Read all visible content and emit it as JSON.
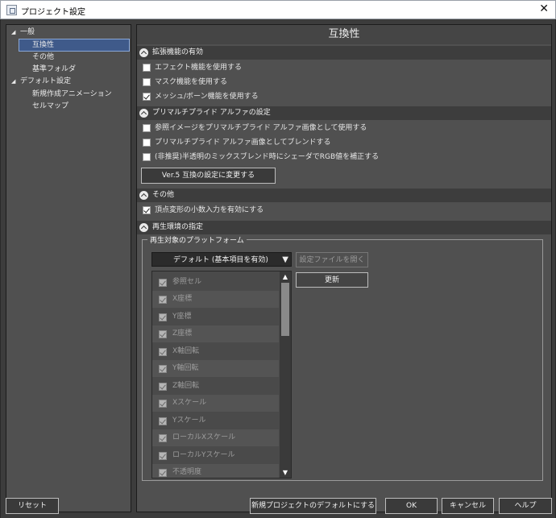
{
  "window": {
    "title": "プロジェクト設定",
    "close_label": "✕"
  },
  "tree": {
    "items": [
      {
        "label": "一般",
        "expanded": true
      },
      {
        "label": "互換性",
        "selected": true
      },
      {
        "label": "その他"
      },
      {
        "label": "基準フォルダ"
      },
      {
        "label": "デフォルト設定",
        "expanded": true
      },
      {
        "label": "新規作成アニメーション"
      },
      {
        "label": "セルマップ"
      }
    ]
  },
  "panel": {
    "title": "互換性"
  },
  "sections": {
    "extensions": {
      "header": "拡張機能の有効",
      "options": [
        {
          "label": "エフェクト機能を使用する",
          "checked": false
        },
        {
          "label": "マスク機能を使用する",
          "checked": false
        },
        {
          "label": "メッシュ/ボーン機能を使用する",
          "checked": true
        }
      ]
    },
    "premultiplied": {
      "header": "プリマルチプライド アルファの設定",
      "options": [
        {
          "label": "参照イメージをプリマルチプライド アルファ画像として使用する",
          "checked": false
        },
        {
          "label": "プリマルチプライド アルファ画像としてブレンドする",
          "checked": false
        },
        {
          "label": "(非推奨)半透明のミックスブレンド時にシェーダでRGB値を補正する",
          "checked": false
        }
      ],
      "button": "Ver.5 互換の設定に変更する"
    },
    "other": {
      "header": "その他",
      "options": [
        {
          "label": "頂点変形の小数入力を有効にする",
          "checked": true
        }
      ]
    },
    "platform": {
      "header": "再生環境の指定",
      "group_label": "再生対象のプラットフォーム",
      "dropdown": "デフォルト (基本項目を有効)",
      "open_file_button": "設定ファイルを開く",
      "update_button": "更新",
      "items": [
        "参照セル",
        "X座標",
        "Y座標",
        "Z座標",
        "X軸回転",
        "Y軸回転",
        "Z軸回転",
        "Xスケール",
        "Yスケール",
        "ローカルXスケール",
        "ローカルYスケール",
        "不透明度"
      ]
    }
  },
  "footer": {
    "reset": "リセット",
    "make_default": "新規プロジェクトのデフォルトにする",
    "ok": "OK",
    "cancel": "キャンセル",
    "help": "ヘルプ"
  }
}
